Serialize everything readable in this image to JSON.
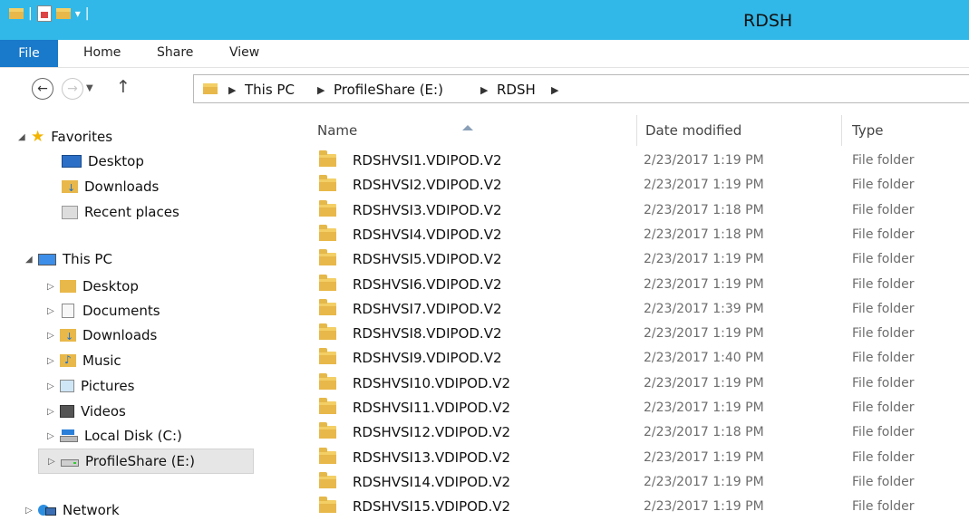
{
  "window": {
    "title": "RDSH"
  },
  "ribbon": {
    "tabs": [
      "File",
      "Home",
      "Share",
      "View"
    ]
  },
  "address": {
    "crumbs": [
      "This PC",
      "ProfileShare (E:)",
      "RDSH"
    ]
  },
  "nav": {
    "favorites_label": "Favorites",
    "favorites": [
      "Desktop",
      "Downloads",
      "Recent places"
    ],
    "thispc_label": "This PC",
    "thispc": [
      "Desktop",
      "Documents",
      "Downloads",
      "Music",
      "Pictures",
      "Videos",
      "Local Disk (C:)",
      "ProfileShare (E:)"
    ],
    "network_label": "Network",
    "selected": "ProfileShare (E:)"
  },
  "columns": {
    "name": "Name",
    "date": "Date modified",
    "type": "Type"
  },
  "files": [
    {
      "name": "RDSHVSI1.VDIPOD.V2",
      "date": "2/23/2017 1:19 PM",
      "type": "File folder"
    },
    {
      "name": "RDSHVSI2.VDIPOD.V2",
      "date": "2/23/2017 1:19 PM",
      "type": "File folder"
    },
    {
      "name": "RDSHVSI3.VDIPOD.V2",
      "date": "2/23/2017 1:18 PM",
      "type": "File folder"
    },
    {
      "name": "RDSHVSI4.VDIPOD.V2",
      "date": "2/23/2017 1:18 PM",
      "type": "File folder"
    },
    {
      "name": "RDSHVSI5.VDIPOD.V2",
      "date": "2/23/2017 1:19 PM",
      "type": "File folder"
    },
    {
      "name": "RDSHVSI6.VDIPOD.V2",
      "date": "2/23/2017 1:19 PM",
      "type": "File folder"
    },
    {
      "name": "RDSHVSI7.VDIPOD.V2",
      "date": "2/23/2017 1:39 PM",
      "type": "File folder"
    },
    {
      "name": "RDSHVSI8.VDIPOD.V2",
      "date": "2/23/2017 1:19 PM",
      "type": "File folder"
    },
    {
      "name": "RDSHVSI9.VDIPOD.V2",
      "date": "2/23/2017 1:40 PM",
      "type": "File folder"
    },
    {
      "name": "RDSHVSI10.VDIPOD.V2",
      "date": "2/23/2017 1:19 PM",
      "type": "File folder"
    },
    {
      "name": "RDSHVSI11.VDIPOD.V2",
      "date": "2/23/2017 1:19 PM",
      "type": "File folder"
    },
    {
      "name": "RDSHVSI12.VDIPOD.V2",
      "date": "2/23/2017 1:18 PM",
      "type": "File folder"
    },
    {
      "name": "RDSHVSI13.VDIPOD.V2",
      "date": "2/23/2017 1:19 PM",
      "type": "File folder"
    },
    {
      "name": "RDSHVSI14.VDIPOD.V2",
      "date": "2/23/2017 1:19 PM",
      "type": "File folder"
    },
    {
      "name": "RDSHVSI15.VDIPOD.V2",
      "date": "2/23/2017 1:19 PM",
      "type": "File folder"
    }
  ],
  "colors": {
    "titlebar": "#31b8e8",
    "file_tab": "#1979ca",
    "folder": "#e8b84a"
  }
}
